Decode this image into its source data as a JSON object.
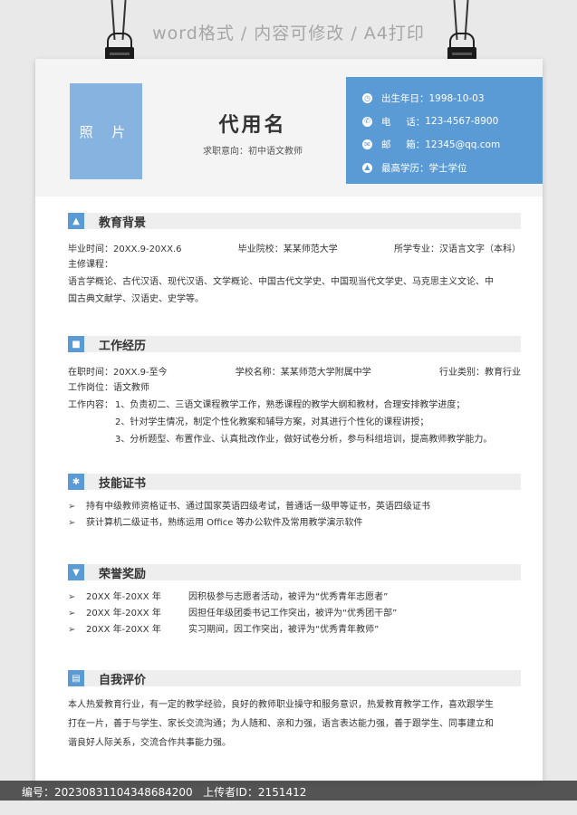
{
  "banner": "word格式 / 内容可修改 / A4打印",
  "header": {
    "photo_label": "照 片",
    "name": "代用名",
    "intent": "求职意向：初中语文教师",
    "info": [
      {
        "icon": "calendar-icon",
        "label": "出生年日：",
        "value": "1998-10-03"
      },
      {
        "icon": "phone-icon",
        "label": "电     话：",
        "value": "123-4567-8900"
      },
      {
        "icon": "mail-icon",
        "label": "邮     箱：",
        "value": "12345@qq.com"
      },
      {
        "icon": "graduation-cap-icon",
        "label": "最高学历：",
        "value": "学士学位"
      }
    ]
  },
  "education": {
    "title": "教育背景",
    "time": "毕业时间：20XX.9-20XX.6",
    "school": "毕业院校：某某师范大学",
    "major": "所学专业：汉语言文字（本科）",
    "courses_label": "主修课程：",
    "courses_line1": "语言学概论、古代汉语、现代汉语、文学概论、中国古代文学史、中国现当代文学史、马克思主义文论、中",
    "courses_line2": "国古典文献学、汉语史、史学等。"
  },
  "work": {
    "title": "工作经历",
    "time": "在职时间：20XX.9-至今",
    "school": "学校名称：某某师范大学附属中学",
    "industry": "行业类别：教育行业",
    "position": "工作岗位：语文教师",
    "content_label": "工作内容：",
    "content": [
      "1、负责初二、三语文课程教学工作，熟悉课程的教学大纲和教材，合理安排教学进度；",
      "2、针对学生情况，制定个性化教案和辅导方案，对其进行个性化的课程讲授；",
      "3、分析题型、布置作业、认真批改作业，做好试卷分析，参与科组培训，提高教师教学能力。"
    ]
  },
  "skills": {
    "title": "技能证书",
    "items": [
      "持有中级教师资格证书、通过国家英语四级考试，普通话一级甲等证书，英语四级证书",
      "获计算机二级证书，熟练运用 Office 等办公软件及常用教学演示软件"
    ]
  },
  "honors": {
    "title": "荣誉奖励",
    "items": [
      {
        "time": "20XX 年-20XX 年",
        "desc": "因积极参与志愿者活动，被评为“优秀青年志愿者”"
      },
      {
        "time": "20XX 年-20XX 年",
        "desc": "因担任年级团委书记工作突出，被评为“优秀团干部”"
      },
      {
        "time": "20XX 年-20XX 年",
        "desc": "实习期间，因工作突出，被评为“优秀青年教师”"
      }
    ]
  },
  "self_eval": {
    "title": "自我评价",
    "lines": [
      "本人热爱教育行业，有一定的教学经验，良好的教师职业操守和服务意识，热爱教育教学工作，喜欢跟学生",
      "打在一片，善于与学生、家长交流沟通；为人随和、亲和力强，语言表达能力强，善于跟学生、同事建立和",
      "谐良好人际关系，交流合作共事能力强。"
    ]
  },
  "footer": {
    "text": "编号：20230831104348684200   上传者ID：2151412"
  },
  "colors": {
    "accent": "#5b9bd5",
    "photo": "#87b3e0"
  }
}
